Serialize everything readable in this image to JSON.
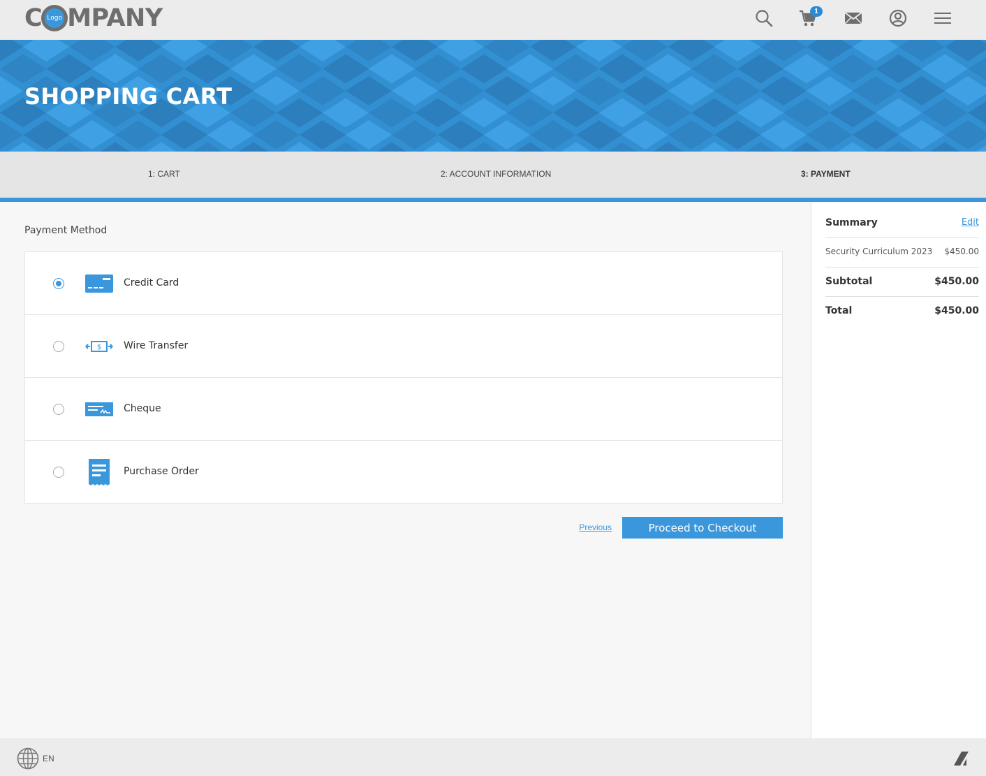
{
  "header": {
    "logo_text_pre": "C",
    "logo_text_post": "MPANY",
    "logo_inner": "Logo",
    "cart_count": "1"
  },
  "banner": {
    "title": "SHOPPING CART"
  },
  "steps": [
    {
      "label": "1: CART",
      "active": false
    },
    {
      "label": "2: ACCOUNT INFORMATION",
      "active": false
    },
    {
      "label": "3: PAYMENT",
      "active": true
    }
  ],
  "payment": {
    "section_title": "Payment Method",
    "methods": [
      {
        "label": "Credit Card",
        "icon": "credit-card-icon",
        "selected": true
      },
      {
        "label": "Wire Transfer",
        "icon": "wire-transfer-icon",
        "selected": false
      },
      {
        "label": "Cheque",
        "icon": "cheque-icon",
        "selected": false
      },
      {
        "label": "Purchase Order",
        "icon": "purchase-order-icon",
        "selected": false
      }
    ],
    "previous_label": "Previous",
    "checkout_label": "Proceed to Checkout"
  },
  "summary": {
    "title": "Summary",
    "edit_label": "Edit",
    "items": [
      {
        "name": "Security Curriculum 2023",
        "price": "$450.00"
      }
    ],
    "subtotal_label": "Subtotal",
    "subtotal_value": "$450.00",
    "total_label": "Total",
    "total_value": "$450.00"
  },
  "footer": {
    "language": "EN"
  },
  "colors": {
    "accent": "#3a97dc",
    "banner": "#3290d2",
    "topbar": "#ececec",
    "icon_gray": "#6e6e6e"
  }
}
